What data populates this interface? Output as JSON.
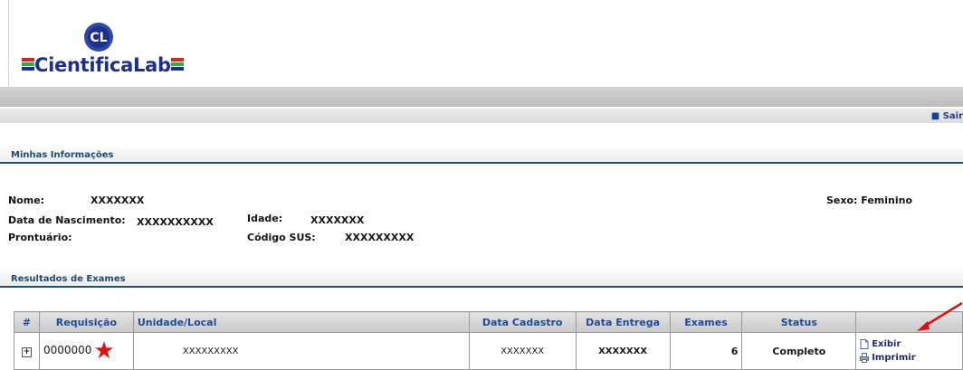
{
  "brand": {
    "logo_initials": "CL",
    "name": "CientificaLab",
    "colors": {
      "blue": "#1d2f8e",
      "green": "#35a84a",
      "red": "#d9261c"
    }
  },
  "nav": {
    "logout_label": "Sair"
  },
  "my_info": {
    "title": "Minhas Informações",
    "name_label": "Nome:",
    "name_value": "XXXXXXX",
    "birth_label": "Data de Nascimento:",
    "birth_value": "XXXXXXXXXX",
    "age_label": "Idade:",
    "age_value": "XXXXXXX",
    "record_label": "Prontuário:",
    "record_value": "",
    "sus_label": "Código SUS:",
    "sus_value": "XXXXXXXXX",
    "sex_label": "Sexo:",
    "sex_value": "Feminino"
  },
  "results": {
    "title": "Resultados de Exames",
    "columns": [
      "#",
      "Requisição",
      "Unidade/Local",
      "Data Cadastro",
      "Data Entrega",
      "Exames",
      "Status"
    ],
    "rows": [
      {
        "expand": "+",
        "requisicao": "0000000",
        "unidade": "XXXXXXXXX",
        "data_cadastro": "XXXXXXX",
        "data_entrega": "XXXXXXX",
        "exames": "6",
        "status": "Completo",
        "actions": [
          "Exibir",
          "Imprimir"
        ]
      }
    ]
  },
  "annotation": {
    "star_icon": "red-star-icon",
    "arrow_icon": "red-arrow-icon",
    "color": "#e01010"
  }
}
